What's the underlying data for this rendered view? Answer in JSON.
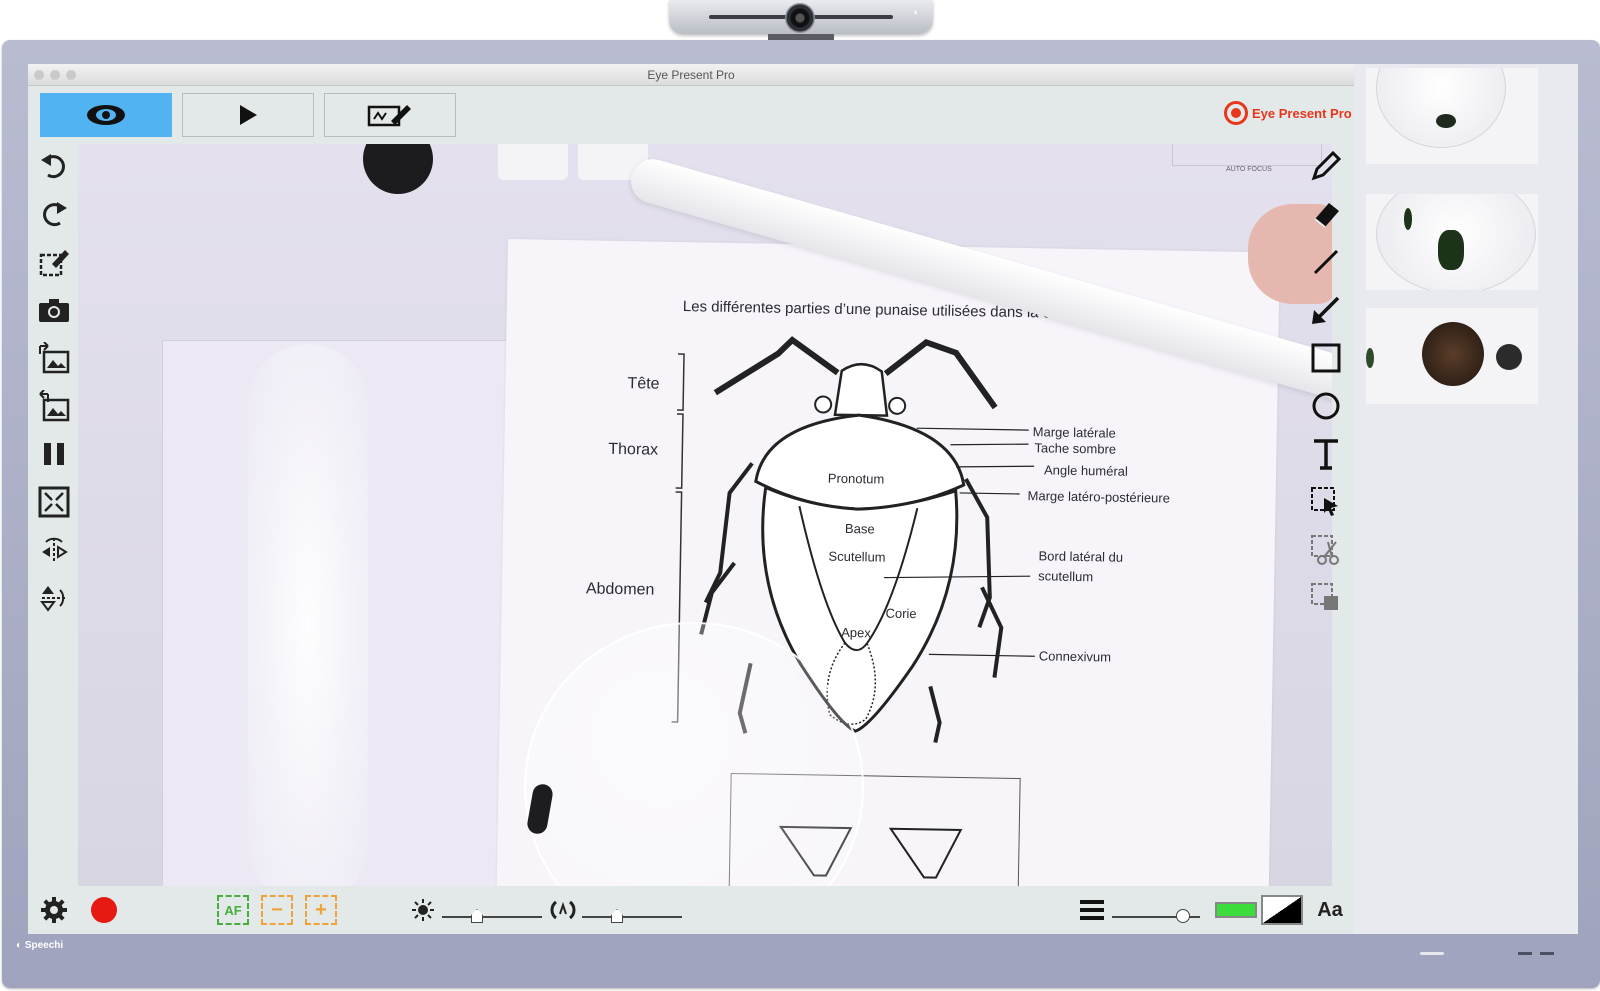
{
  "window": {
    "title": "Eye Present Pro"
  },
  "device": {
    "brand": "Speechi",
    "webcam_mark": "◐"
  },
  "header": {
    "logo_text": "Eye Present Pro",
    "modes": [
      {
        "name": "live-view",
        "icon": "eye-icon",
        "active": true
      },
      {
        "name": "playback",
        "icon": "play-icon",
        "active": false
      },
      {
        "name": "annotate",
        "icon": "whiteboard-pen-icon",
        "active": false
      }
    ]
  },
  "left_tools": [
    "undo-icon",
    "redo-icon",
    "annotate-icon",
    "camera-icon",
    "import-image-icon",
    "export-image-icon",
    "pause-icon",
    "fullscreen-icon",
    "flip-horizontal-icon",
    "rotate-icon"
  ],
  "right_tools": [
    "pencil-icon",
    "eraser-icon",
    "line-icon",
    "arrow-icon",
    "rectangle-icon",
    "circle-icon",
    "text-icon",
    "select-icon",
    "cut-icon",
    "copy-icon"
  ],
  "camera_view": {
    "autofocus_label": "AUTO FOCUS",
    "sheet_title": "Les différentes parties d’une punaise utilisées dans la clé",
    "sections": [
      "Tête",
      "Thorax",
      "Abdomen"
    ],
    "labels": {
      "pronotum": "Pronotum",
      "base": "Base",
      "scutellum": "Scutellum",
      "apex": "Apex",
      "corie": "Corie",
      "marge_laterale": "Marge latérale",
      "tache_sombre": "Tache sombre",
      "angle_humeral": "Angle huméral",
      "marge_latero": "Marge latéro-postérieure",
      "bord_lateral_1": "Bord latéral du",
      "bord_lateral_2": "scutellum",
      "connexivum": "Connexivum"
    }
  },
  "bottom_bar": {
    "af_label": "AF",
    "zoom_out_label": "−",
    "zoom_in_label": "+",
    "brightness_level": 0.35,
    "contrast_level": 0.35,
    "line_width_level": 0.8,
    "color": "#3ddc3d",
    "font_label": "Aa"
  },
  "thumbnails": [
    {
      "name": "thumb-beetle-dish"
    },
    {
      "name": "thumb-plant-dish"
    },
    {
      "name": "thumb-chestnut-burr"
    }
  ],
  "colors": {
    "accent": "#52b3f2",
    "logo": "#e8351c",
    "record": "#e71a13",
    "af": "#47ad3b",
    "zoom": "#f0a13a"
  }
}
